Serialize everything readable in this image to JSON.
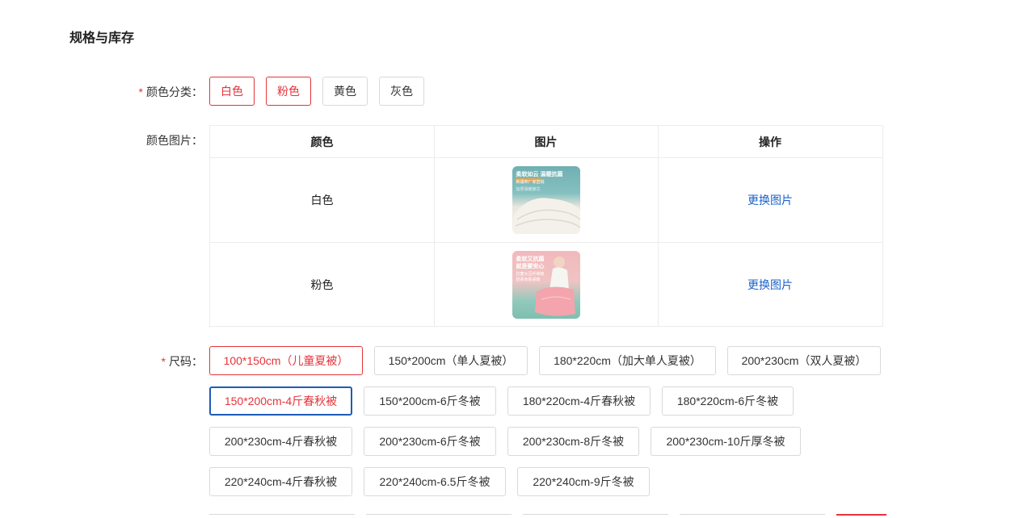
{
  "section_title": "规格与库存",
  "color_category": {
    "label": "颜色分类：",
    "required_mark": "*",
    "options": [
      {
        "label": "白色",
        "selected": true
      },
      {
        "label": "粉色",
        "selected": true
      },
      {
        "label": "黄色",
        "selected": false
      },
      {
        "label": "灰色",
        "selected": false
      }
    ]
  },
  "color_images": {
    "label": "颜色图片：",
    "headers": [
      "颜色",
      "图片",
      "操作"
    ],
    "rows": [
      {
        "color": "白色",
        "action": "更换图片",
        "thumb_caption": "柔软如云 温暖抗菌",
        "thumb_tag": "新疆棉厂家直销",
        "thumb_note": "加厚保暖被芯"
      },
      {
        "color": "粉色",
        "action": "更换图片",
        "thumb_caption": "柔软又抗菌 就是要安心",
        "thumb_tag": "抗菌大豆纤维被",
        "thumb_note": "轻柔亲肤保暖"
      }
    ]
  },
  "size": {
    "label": "尺码：",
    "required_mark": "*",
    "options": [
      {
        "label": "100*150cm（儿童夏被）",
        "state": "selected"
      },
      {
        "label": "150*200cm（单人夏被）",
        "state": "none"
      },
      {
        "label": "180*220cm（加大单人夏被）",
        "state": "none"
      },
      {
        "label": "200*230cm（双人夏被）",
        "state": "none"
      },
      {
        "label": "150*200cm-4斤春秋被",
        "state": "focused"
      },
      {
        "label": "150*200cm-6斤冬被",
        "state": "none"
      },
      {
        "label": "180*220cm-4斤春秋被",
        "state": "none"
      },
      {
        "label": "180*220cm-6斤冬被",
        "state": "none"
      },
      {
        "label": "200*230cm-4斤春秋被",
        "state": "none"
      },
      {
        "label": "200*230cm-6斤冬被",
        "state": "none"
      },
      {
        "label": "200*230cm-8斤冬被",
        "state": "none"
      },
      {
        "label": "200*230cm-10斤厚冬被",
        "state": "none"
      },
      {
        "label": "220*240cm-4斤春秋被",
        "state": "none"
      },
      {
        "label": "220*240cm-6.5斤冬被",
        "state": "none"
      },
      {
        "label": "220*240cm-9斤冬被",
        "state": "none"
      }
    ]
  },
  "colors": {
    "accent_red": "#e5343a",
    "link_blue": "#1a62c9",
    "focus_blue": "#1e5bb8"
  }
}
